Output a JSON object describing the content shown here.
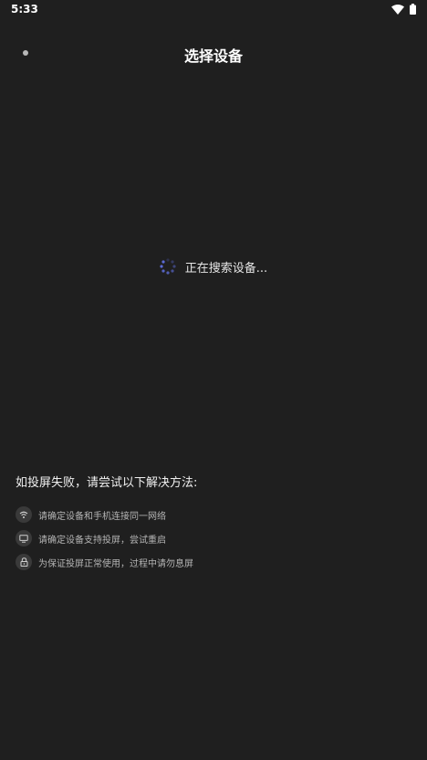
{
  "status_bar": {
    "time": "5:33",
    "icons": [
      "wifi-icon",
      "battery-icon"
    ]
  },
  "header": {
    "back_icon": "back-dot-icon",
    "title": "选择设备"
  },
  "search": {
    "spinner_icon": "loading-spinner-icon",
    "text": "正在搜索设备..."
  },
  "tips": {
    "heading": "如投屏失败，请尝试以下解决方法:",
    "items": [
      {
        "icon": "wifi-icon",
        "text": "请确定设备和手机连接同一网络"
      },
      {
        "icon": "tv-icon",
        "text": "请确定设备支持投屏，尝试重启"
      },
      {
        "icon": "lock-icon",
        "text": "为保证投屏正常使用，过程中请勿息屏"
      }
    ]
  },
  "colors": {
    "background": "#1f1f1f",
    "spinner": "#5c6bd6",
    "tip_icon_bg": "#3a3a3a"
  }
}
